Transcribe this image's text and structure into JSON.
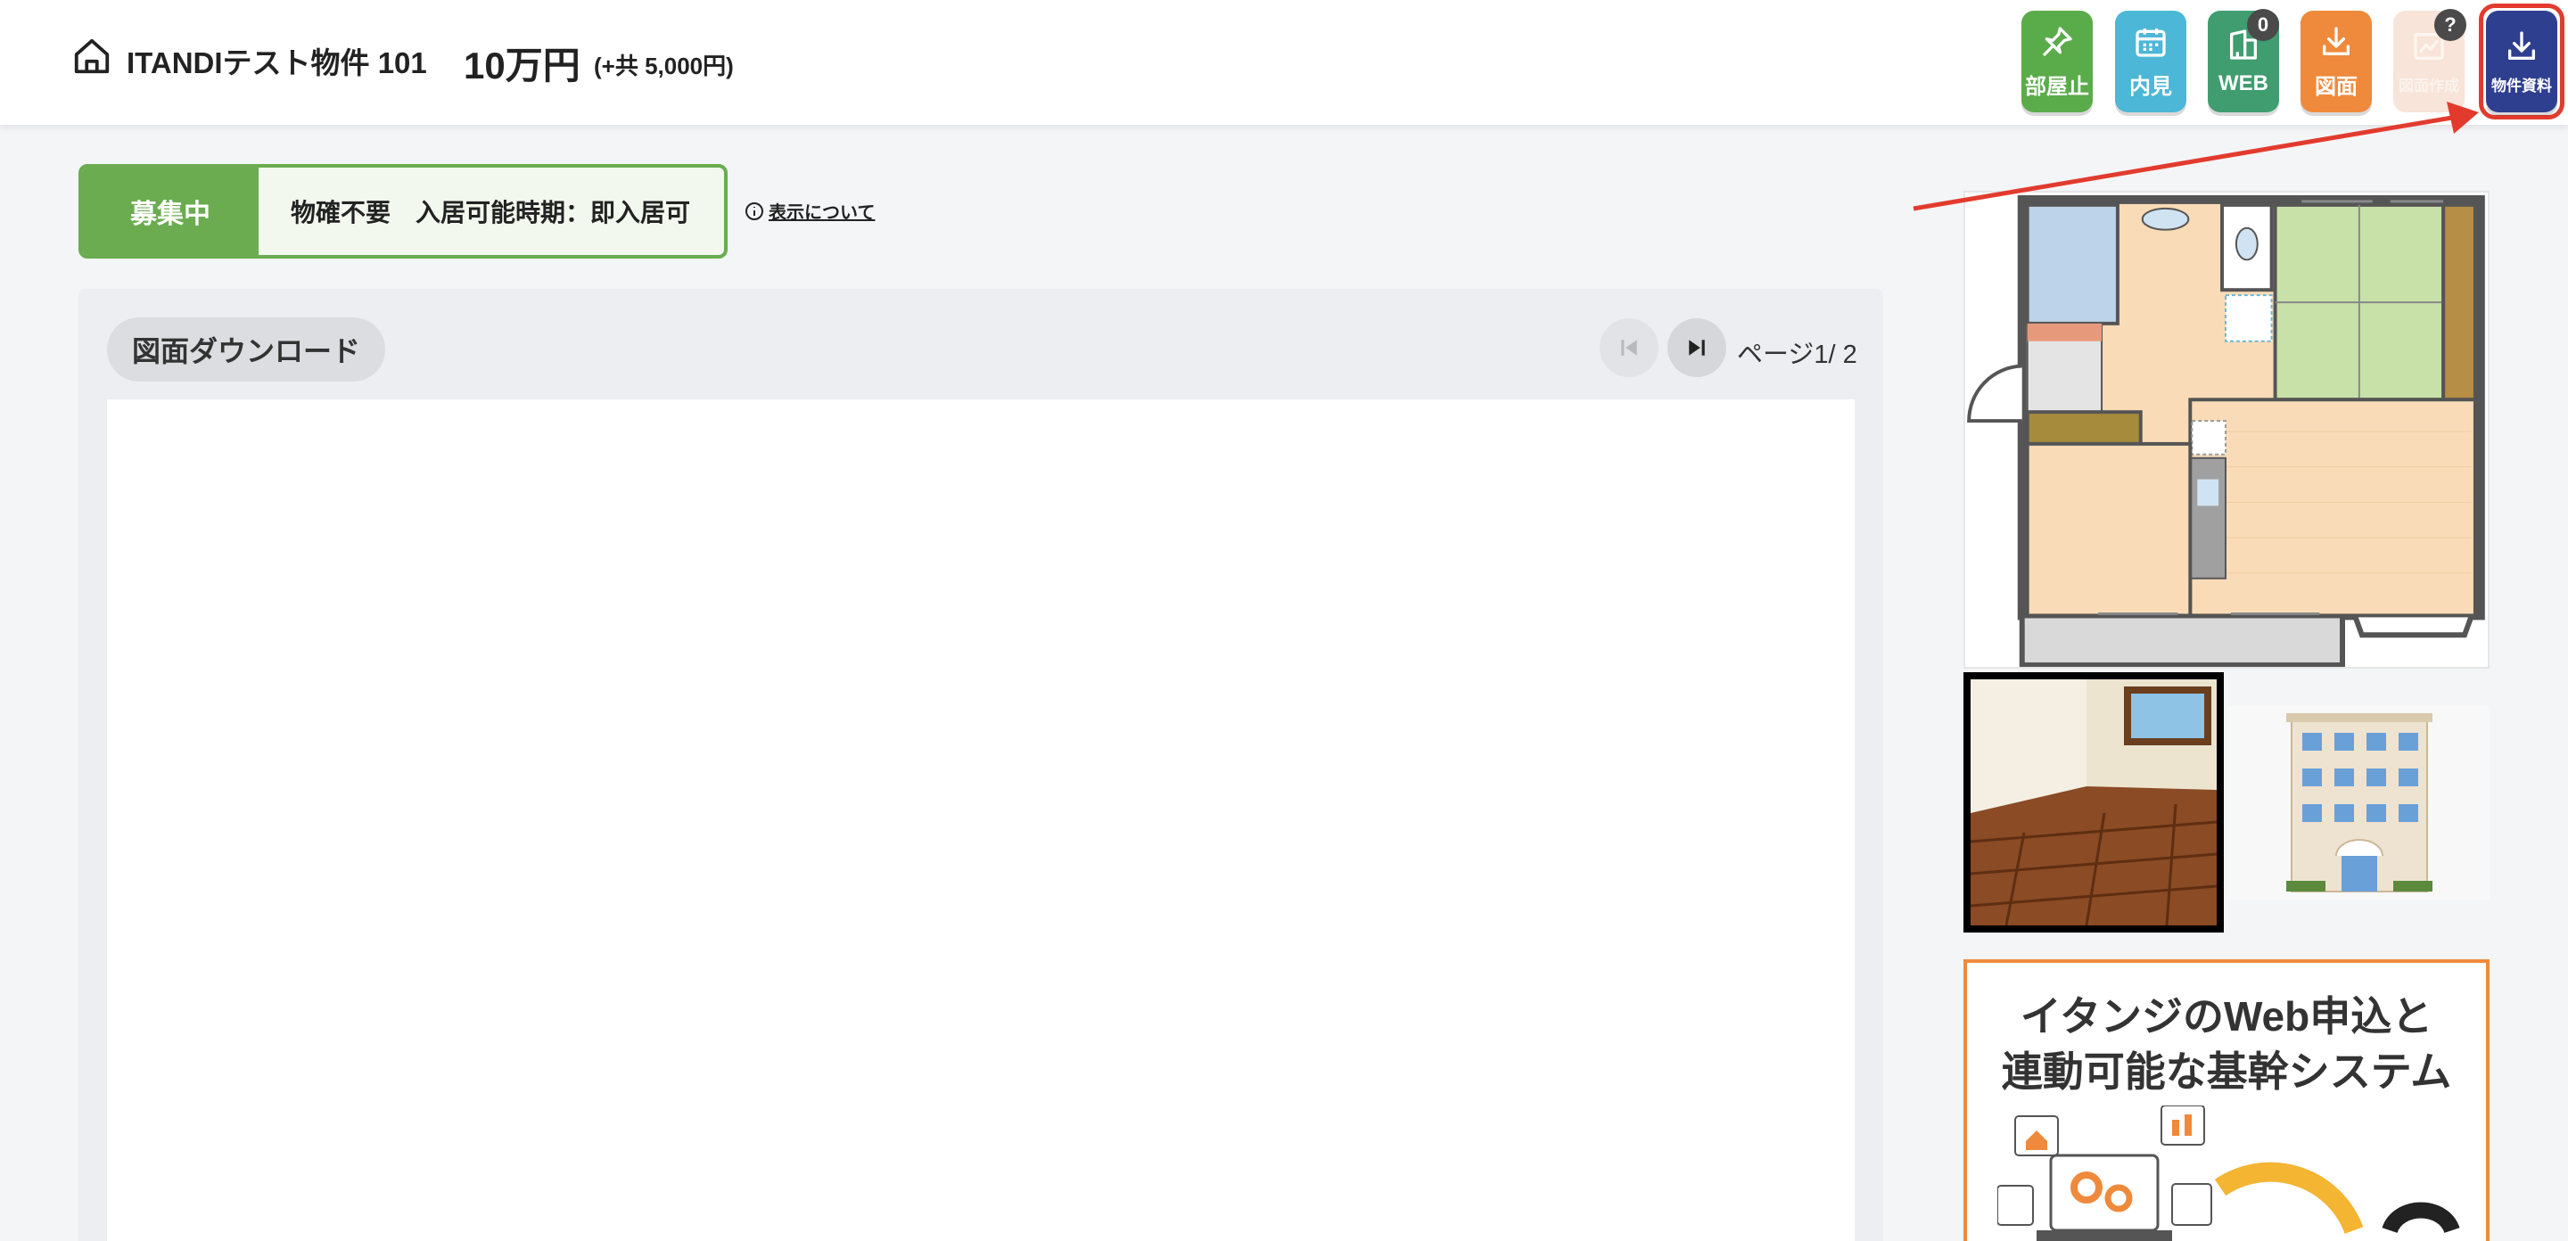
{
  "header": {
    "property_name": "ITANDIテスト物件 101",
    "rent": "10万円",
    "common_fee": "(+共 5,000円)",
    "buttons": [
      {
        "label": "部屋止",
        "icon": "pin-icon",
        "color": "#5aab4a"
      },
      {
        "label": "内見",
        "icon": "calendar-icon",
        "color": "#4cb7d6"
      },
      {
        "label": "WEB",
        "icon": "building-icon",
        "color": "#3f9d70",
        "badge": "0"
      },
      {
        "label": "図面",
        "icon": "download-icon",
        "color": "#ef8a3c"
      },
      {
        "label": "図面作成",
        "icon": "chart-icon",
        "color": "#f8e4d8",
        "badge": "?"
      },
      {
        "label": "物件資料",
        "icon": "download-icon",
        "color": "#2f3f8f",
        "highlighted": true
      }
    ]
  },
  "status": {
    "tag": "募集中",
    "text": "物確不要　入居可能時期：即入居可",
    "display_info_link": "表示について"
  },
  "main": {
    "title": "図面ダウンロード",
    "page_indicator": "ページ1/ 2"
  },
  "ad": {
    "line1": "イタンジのWeb申込と",
    "line2": "連動可能な基幹システム"
  },
  "colors": {
    "accent_green": "#6aac4f",
    "highlight_red": "#e23b2e",
    "material_navy": "#2f3f8f"
  }
}
